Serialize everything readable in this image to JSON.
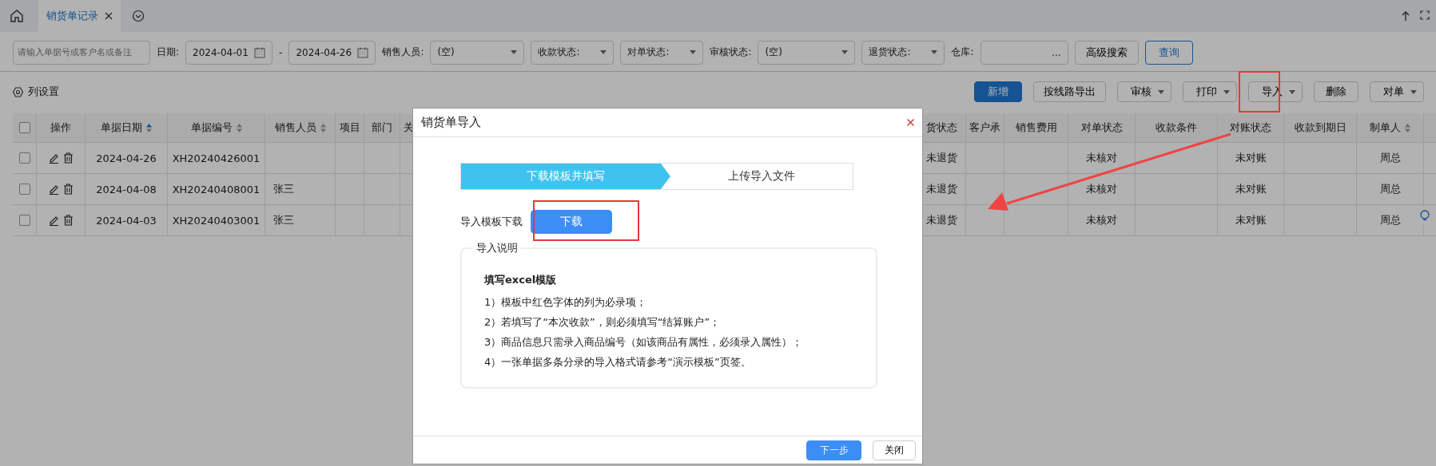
{
  "tabs": [
    {
      "label": "销货单记录",
      "selected": true
    }
  ],
  "filters": [
    {
      "kind": "input",
      "placeholder": "请输入单据号或客户名或备注"
    },
    {
      "kind": "label",
      "text": "日期:"
    },
    {
      "kind": "date",
      "value": "2024-04-01"
    },
    {
      "kind": "label",
      "text": "-"
    },
    {
      "kind": "date",
      "value": "2024-04-26"
    },
    {
      "kind": "label",
      "text": "销售人员:"
    },
    {
      "kind": "select",
      "value": "(空)"
    },
    {
      "kind": "select",
      "value": "收款状态:"
    },
    {
      "kind": "select",
      "value": "对单状态:"
    },
    {
      "kind": "label",
      "text": "审核状态:"
    },
    {
      "kind": "select",
      "value": "(空)"
    },
    {
      "kind": "select",
      "value": "退货状态:"
    },
    {
      "kind": "label",
      "text": "仓库:"
    },
    {
      "kind": "lookup",
      "value": "..."
    },
    {
      "kind": "button",
      "text": "高级搜索"
    },
    {
      "kind": "query",
      "text": "查询"
    }
  ],
  "column_settings": "列设置",
  "actions": [
    {
      "text": "新增",
      "kind": "primary"
    },
    {
      "text": "按线路导出",
      "kind": "plain"
    },
    {
      "text": "审核",
      "kind": "dropdown"
    },
    {
      "text": "打印",
      "kind": "dropdown"
    },
    {
      "text": "导入",
      "kind": "dropdown"
    },
    {
      "text": "删除",
      "kind": "plain"
    },
    {
      "text": "对单",
      "kind": "dropdown"
    }
  ],
  "table": {
    "header_checked": false,
    "columns": [
      {
        "label": "操作",
        "sortable": false
      },
      {
        "label": "单据日期",
        "sortable": true,
        "sorted": true
      },
      {
        "label": "单据编号",
        "sortable": true,
        "sorted": false
      },
      {
        "label": "销售人员",
        "sortable": true,
        "sorted": false
      },
      {
        "label": "项目",
        "sortable": false
      },
      {
        "label": "部门",
        "sortable": false
      },
      {
        "label": "关",
        "sortable": false
      },
      {
        "label": "货状态",
        "sortable": false
      },
      {
        "label": "客户承",
        "sortable": false
      },
      {
        "label": "销售费用",
        "sortable": false
      },
      {
        "label": "对单状态",
        "sortable": false
      },
      {
        "label": "收款条件",
        "sortable": false
      },
      {
        "label": "对账状态",
        "sortable": false
      },
      {
        "label": "收款到期日",
        "sortable": false
      },
      {
        "label": "制单人",
        "sortable": true,
        "sorted": false
      }
    ],
    "rows": [
      {
        "checked": false,
        "date": "2024-04-26",
        "number": "XH20240426001",
        "return_status": "未退货",
        "check_status": "未核对",
        "reconcile_status": "未对账",
        "creator": "周总"
      },
      {
        "checked": false,
        "date": "2024-04-08",
        "number": "XH20240408001",
        "salesperson": "张三",
        "return_status": "未退货",
        "check_status": "未核对",
        "reconcile_status": "未对账",
        "creator": "周总"
      },
      {
        "checked": false,
        "date": "2024-04-03",
        "number": "XH20240403001",
        "salesperson": "张三",
        "return_status": "未退货",
        "check_status": "未核对",
        "reconcile_status": "未对账",
        "creator": "周总"
      }
    ]
  },
  "dialog": {
    "title": "销货单导入",
    "steps": [
      {
        "label": "下载模板并填写",
        "selected": true
      },
      {
        "label": "上传导入文件",
        "selected": false
      }
    ],
    "template_label": "导入模板下载",
    "download_button": "下载",
    "notes_legend": "导入说明",
    "notes_title": "填写excel模版",
    "notes": [
      "1）模板中红色字体的列为必录项；",
      "2）若填写了“本次收款”，则必须填写“结算账户”；",
      "3）商品信息只需录入商品编号（如该商品有属性，必须录入属性）；",
      "4）一张单据多条分录的导入格式请参考“演示模板”页签。"
    ],
    "buttons": [
      {
        "text": "下一步",
        "primary": true
      },
      {
        "text": "关闭",
        "primary": false
      }
    ]
  }
}
